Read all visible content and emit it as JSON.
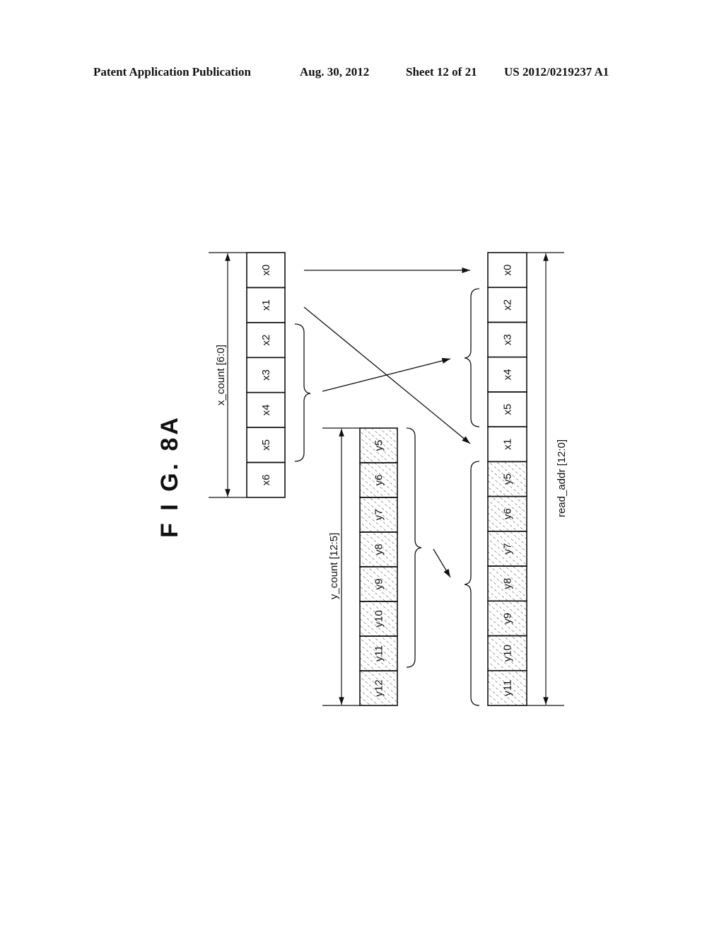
{
  "header": {
    "publication": "Patent Application Publication",
    "date": "Aug. 30, 2012",
    "sheet": "Sheet 12 of 21",
    "number": "US 2012/0219237 A1"
  },
  "figure": {
    "label": "F I G. 8A",
    "x_count_column": {
      "dimension_label": "x_count [6:0]",
      "cells": [
        "x0",
        "x1",
        "x2",
        "x3",
        "x4",
        "x5",
        "x6"
      ],
      "hatched": false
    },
    "y_count_column": {
      "dimension_label": "y_count [12:5]",
      "cells": [
        "y5",
        "y6",
        "y7",
        "y8",
        "y9",
        "y10",
        "y11",
        "y12"
      ],
      "hatched": true
    },
    "read_addr_column": {
      "dimension_label": "read_addr [12:0]",
      "cells": [
        {
          "label": "x0",
          "hatched": false
        },
        {
          "label": "x2",
          "hatched": false
        },
        {
          "label": "x3",
          "hatched": false
        },
        {
          "label": "x4",
          "hatched": false
        },
        {
          "label": "x5",
          "hatched": false
        },
        {
          "label": "x1",
          "hatched": false
        },
        {
          "label": "y5",
          "hatched": true
        },
        {
          "label": "y6",
          "hatched": true
        },
        {
          "label": "y7",
          "hatched": true
        },
        {
          "label": "y8",
          "hatched": true
        },
        {
          "label": "y9",
          "hatched": true
        },
        {
          "label": "y10",
          "hatched": true
        },
        {
          "label": "y11",
          "hatched": true
        }
      ]
    },
    "mappings": [
      {
        "from": "x0",
        "to": "x0"
      },
      {
        "from": "x1",
        "to": "x1"
      },
      {
        "from": "x2..x5",
        "to": "x2..x5"
      },
      {
        "from": "y5..y11",
        "to": "y5..y11"
      }
    ]
  }
}
